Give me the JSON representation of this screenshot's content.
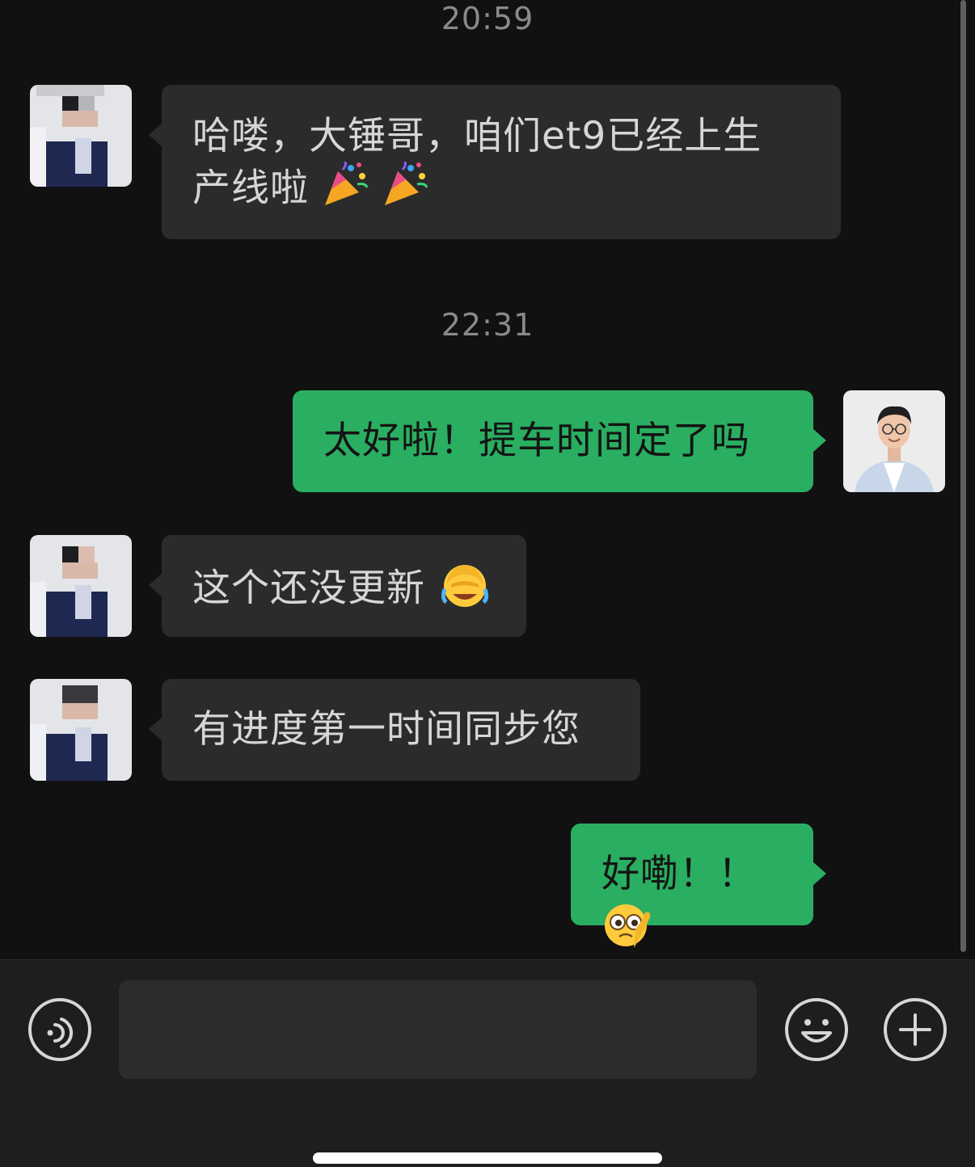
{
  "timestamps": [
    "20:59",
    "22:31"
  ],
  "messages": [
    {
      "side": "in",
      "text": "哈喽，大锤哥，咱们et9已经上生",
      "text_line2": "产线啦",
      "emojis": [
        "party-popper-icon",
        "party-popper-icon"
      ]
    },
    {
      "side": "out",
      "text": "太好啦！提车时间定了吗"
    },
    {
      "side": "in",
      "text": "这个还没更新",
      "emojis": [
        "facepalm-tears-icon"
      ]
    },
    {
      "side": "in",
      "text": "有进度第一时间同步您"
    },
    {
      "side": "out",
      "text": "好嘞！！",
      "emojis": [
        "salute-thinking-face-icon"
      ]
    }
  ],
  "input_bar": {
    "voice_icon": "voice-icon",
    "text_value": "",
    "emoji_icon": "smiley-icon",
    "more_icon": "plus-icon"
  },
  "colors": {
    "background": "#111111",
    "incoming_bubble": "#2b2b2b",
    "outgoing_bubble": "#2aae61",
    "input_bar": "#1e1e1e"
  }
}
